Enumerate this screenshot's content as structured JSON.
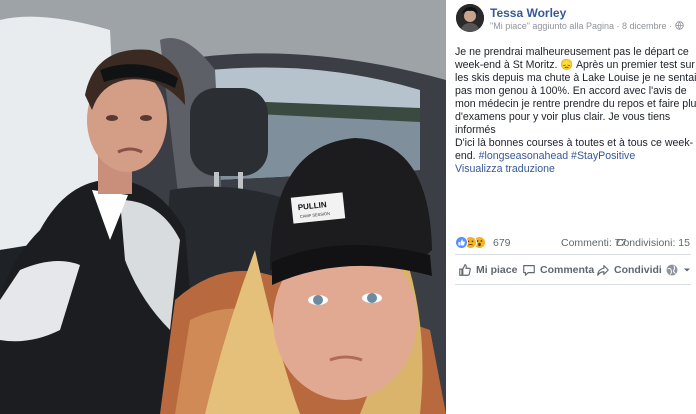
{
  "post": {
    "author": "Tessa Worley",
    "meta": "\"Mi piace\" aggiunto alla Pagina · 8 dicembre ·",
    "text_lines": [
      "Je ne prendrai malheureusement pas le départ ce",
      "week-end à St Moritz. 😞 Après un premier test sur",
      "les skis depuis ma chute à Lake Louise je ne sentais",
      "pas mon genou à 100%. En accord avec l'avis de",
      "mon médecin je rentre prendre du repos et faire plus",
      "d'examens pour y voir plus clair. Je vous tiens",
      "informés",
      "D'ici là bonnes courses à toutes et à tous ce week-",
      "end."
    ],
    "hashtags": "#longseasonahead #StayPositive",
    "translate": "Visualizza traduzione"
  },
  "stats": {
    "reaction_count": "679",
    "comments": "Commenti: 77",
    "shares": "Condivisioni: 15"
  },
  "actions": {
    "like": "Mi piace",
    "comment": "Commenta",
    "share": "Condividi"
  },
  "photo": {
    "beanie_text": "PULLIN",
    "beanie_subtext": "CAMP SESSION"
  },
  "colors": {
    "link": "#365899",
    "text": "#1d2129",
    "muted": "#90949c",
    "action": "#606770",
    "like_blue": "#5890ff",
    "emoji_yellow": "#f7b125"
  },
  "icons": {
    "like": "thumbs-up-icon",
    "comment": "speech-bubble-icon",
    "share": "share-arrow-icon",
    "audience": "globe-icon",
    "caret": "caret-down-icon"
  }
}
